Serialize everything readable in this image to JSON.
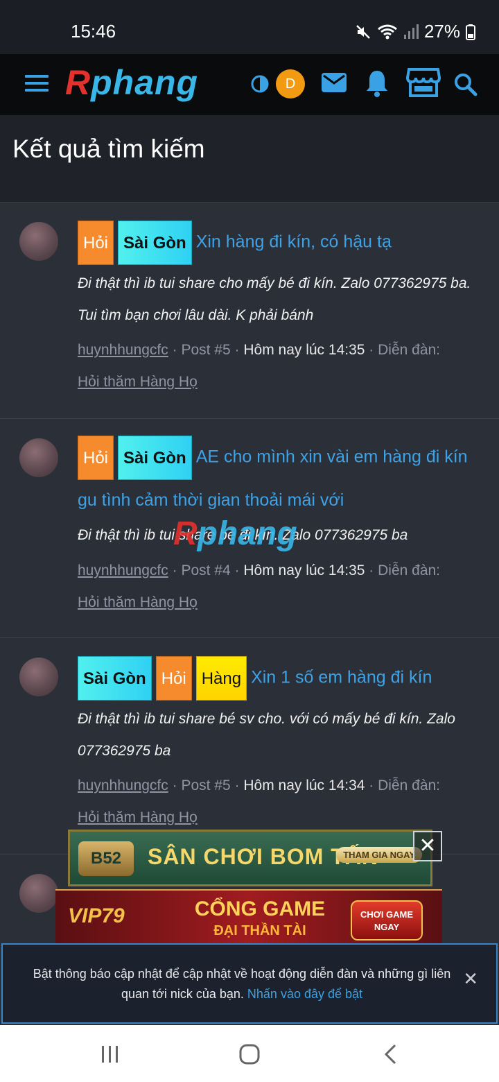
{
  "status_bar": {
    "time": "15:46",
    "battery": "27%"
  },
  "header": {
    "logo_r": "R",
    "logo_rest": "phang",
    "user_initial": "D"
  },
  "page": {
    "title": "Kết quả tìm kiếm"
  },
  "results": [
    {
      "tags": [
        "Hỏi",
        "Sài Gòn"
      ],
      "title": "Xin hàng đi kín, có hậu tạ",
      "snippet": "Đi thật thì ib tui share cho mấy bé đi kín. Zalo 077362975 ba. Tui tìm bạn chơi lâu dài. K phải bánh",
      "author": "huynhhungcfc",
      "post": "Post #5",
      "date": "Hôm nay lúc 14:35",
      "forum_label": "Diễn đàn:",
      "forum": "Hỏi thăm Hàng Họ"
    },
    {
      "tags": [
        "Hỏi",
        "Sài Gòn"
      ],
      "title": "AE cho mình xin vài em hàng đi kín gu tình cảm thời gian thoải mái với",
      "snippet": "Đi thật thì ib tui share bé đi kín. Zalo 077362975 ba",
      "author": "huynhhungcfc",
      "post": "Post #4",
      "date": "Hôm nay lúc 14:35",
      "forum_label": "Diễn đàn:",
      "forum": "Hỏi thăm Hàng Họ"
    },
    {
      "tags": [
        "Sài Gòn",
        "Hỏi",
        "Hàng"
      ],
      "title": "Xin 1 số em hàng đi kín",
      "snippet": "Đi thật thì ib tui share bé sv cho. với có mấy bé đi kín. Zalo 077362975 ba",
      "author": "huynhhungcfc",
      "post": "Post #5",
      "date": "Hôm nay lúc 14:34",
      "forum_label": "Diễn đàn:",
      "forum": "Hỏi thăm Hàng Họ"
    }
  ],
  "watermark": {
    "r": "R",
    "rest": "phang"
  },
  "ads": {
    "ad1": {
      "brand": "B52",
      "slogan": "SÂN CHƠI BOM TẤN",
      "cta": "THAM GIA NGAY"
    },
    "ad2": {
      "brand": "VIP79",
      "line1": "CỔNG GAME",
      "line2": "ĐẠI THẦN TÀI",
      "cta": "CHƠI GAME NGAY"
    }
  },
  "notice": {
    "text": "Bật thông báo cập nhật để cập nhật về hoạt động diễn đàn và những gì liên quan tới nick của bạn.",
    "link": "Nhấn vào đây để bật"
  },
  "colors": {
    "accent": "#3aa2e4",
    "bg": "#2b2f38",
    "tag_hoi": "#f58b2c",
    "tag_sg": "#40e0f0",
    "tag_hang": "#ffe600"
  }
}
